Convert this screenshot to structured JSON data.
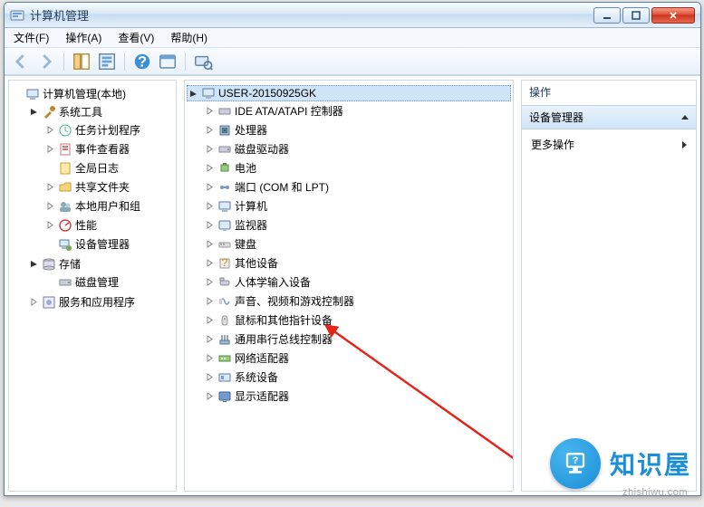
{
  "window": {
    "title": "计算机管理"
  },
  "menu": {
    "file": "文件(F)",
    "action": "操作(A)",
    "view": "查看(V)",
    "help": "帮助(H)"
  },
  "toolbar": {
    "back": "back-icon",
    "forward": "forward-icon",
    "up": "up-icon",
    "props": "properties-icon",
    "help": "help-icon",
    "refresh": "refresh-icon",
    "find": "find-icon"
  },
  "leftTree": {
    "root": "计算机管理(本地)",
    "systemTools": {
      "label": "系统工具",
      "items": [
        "任务计划程序",
        "事件查看器",
        "全局日志",
        "共享文件夹",
        "本地用户和组",
        "性能",
        "设备管理器"
      ]
    },
    "storage": {
      "label": "存储",
      "items": [
        "磁盘管理"
      ]
    },
    "services": "服务和应用程序"
  },
  "midTree": {
    "root": "USER-20150925GK",
    "items": [
      "IDE ATA/ATAPI 控制器",
      "处理器",
      "磁盘驱动器",
      "电池",
      "端口 (COM 和 LPT)",
      "计算机",
      "监视器",
      "键盘",
      "其他设备",
      "人体学输入设备",
      "声音、视频和游戏控制器",
      "鼠标和其他指针设备",
      "通用串行总线控制器",
      "网络适配器",
      "系统设备",
      "显示适配器"
    ]
  },
  "rightPane": {
    "title": "操作",
    "selected": "设备管理器",
    "more": "更多操作"
  },
  "watermark": {
    "brand": "知识屋",
    "url": "zhishiwu.com"
  }
}
